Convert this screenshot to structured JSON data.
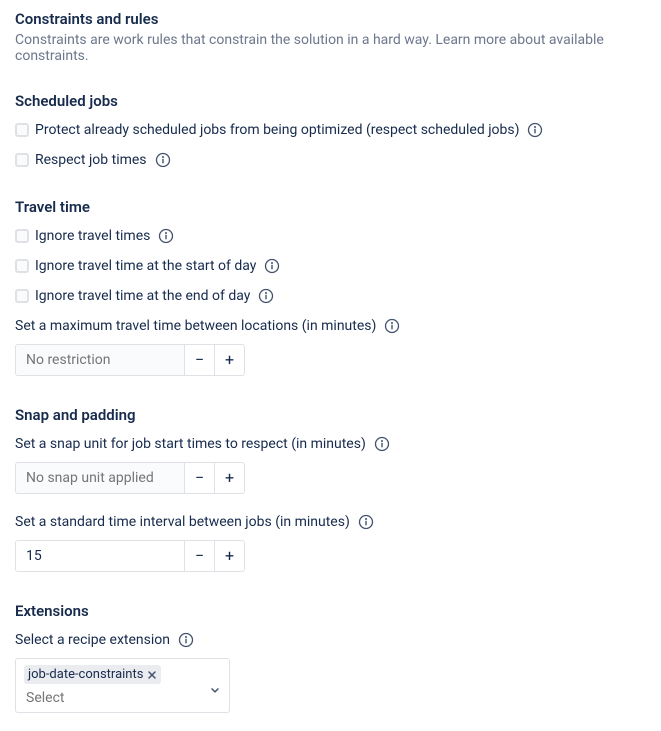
{
  "header": {
    "title": "Constraints and rules",
    "description": "Constraints are work rules that constrain the solution in a hard way. Learn more about available constraints."
  },
  "scheduled_jobs": {
    "title": "Scheduled jobs",
    "protect_label": "Protect already scheduled jobs from being optimized (respect scheduled jobs)",
    "respect_times_label": "Respect job times"
  },
  "travel_time": {
    "title": "Travel time",
    "ignore_travel_label": "Ignore travel times",
    "ignore_start_label": "Ignore travel time at the start of day",
    "ignore_end_label": "Ignore travel time at the end of day",
    "max_travel_label": "Set a maximum travel time between locations (in minutes)",
    "max_travel_placeholder": "No restriction"
  },
  "snap_padding": {
    "title": "Snap and padding",
    "snap_unit_label": "Set a snap unit for job start times to respect (in minutes)",
    "snap_unit_placeholder": "No snap unit applied",
    "interval_label": "Set a standard time interval between jobs (in minutes)",
    "interval_value": "15"
  },
  "extensions": {
    "title": "Extensions",
    "select_label": "Select a recipe extension",
    "tag_value": "job-date-constraints",
    "search_placeholder": "Select"
  },
  "stepper": {
    "minus": "−",
    "plus": "+"
  }
}
